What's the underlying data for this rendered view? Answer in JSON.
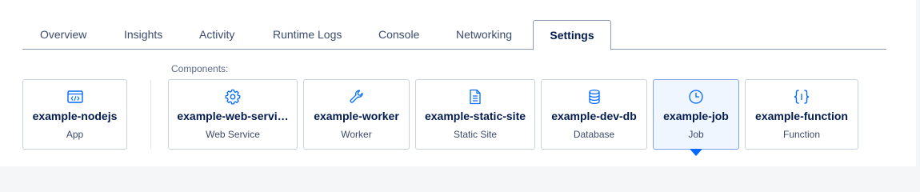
{
  "tabs": [
    {
      "label": "Overview"
    },
    {
      "label": "Insights"
    },
    {
      "label": "Activity"
    },
    {
      "label": "Runtime Logs"
    },
    {
      "label": "Console"
    },
    {
      "label": "Networking"
    },
    {
      "label": "Settings",
      "active": true
    }
  ],
  "app_card": {
    "name": "example-nodejs",
    "type": "App",
    "icon": "code-window-icon"
  },
  "components": {
    "label": "Components:",
    "items": [
      {
        "name": "example-web-servi…",
        "type": "Web Service",
        "icon": "gear-icon"
      },
      {
        "name": "example-worker",
        "type": "Worker",
        "icon": "wrench-icon"
      },
      {
        "name": "example-static-site",
        "type": "Static Site",
        "icon": "document-icon"
      },
      {
        "name": "example-dev-db",
        "type": "Database",
        "icon": "database-icon"
      },
      {
        "name": "example-job",
        "type": "Job",
        "icon": "clock-icon",
        "selected": true
      },
      {
        "name": "example-function",
        "type": "Function",
        "icon": "curly-braces-icon"
      }
    ]
  },
  "colors": {
    "accent": "#0069ff",
    "text": "#031b4e",
    "selected_bg": "#f0f6ff"
  }
}
